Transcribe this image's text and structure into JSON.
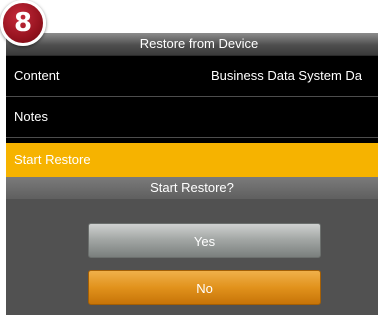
{
  "step_badge": "8",
  "screen": {
    "title": "Restore from Device"
  },
  "rows": [
    {
      "label": "Content",
      "value": "Business Data System Da"
    },
    {
      "label": "Notes",
      "value": ""
    },
    {
      "label": "Start Restore",
      "value": ""
    }
  ],
  "dialog": {
    "title": "Start Restore?",
    "yes_label": "Yes",
    "no_label": "No"
  },
  "colors": {
    "highlight": "#f6b300",
    "badge": "#96131f",
    "yes_button": "#a4a8a6",
    "no_button": "#e1921c"
  }
}
